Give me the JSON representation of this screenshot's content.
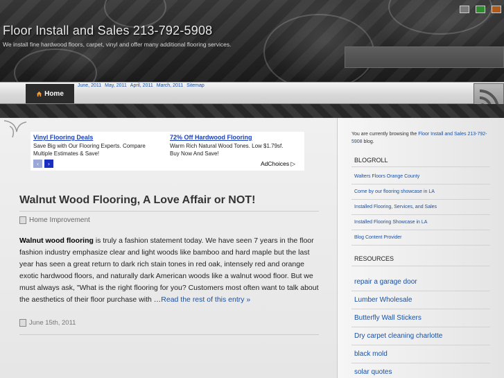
{
  "header": {
    "title": "Floor Install and Sales 213-792-5908",
    "description": "We install fine hardwood floors, carpet, vinyl and offer many additional flooring services.",
    "color_swatches": [
      "#7a7a7a",
      "#2e8b2e",
      "#b05a1a"
    ]
  },
  "nav": {
    "home_label": "Home",
    "home_icon": "house-icon",
    "links": [
      "June, 2011",
      "May, 2011",
      "April, 2011",
      "March, 2011",
      "Sitemap"
    ],
    "rss_icon": "rss-icon"
  },
  "ads": {
    "left": {
      "title": "Vinyl Flooring Deals",
      "text_line1": "Save Big with Our Flooring Experts. Compare",
      "text_line2": "Multiple Estimates & Save!"
    },
    "right": {
      "title": "72% Off Hardwood Flooring",
      "text_line1": "Warm Rich Natural Wood Tones. Low $1.79sf.",
      "text_line2": "Buy Now And Save!"
    },
    "prev_arrow": "‹",
    "next_arrow": "›",
    "adchoices_label": "AdChoices"
  },
  "post": {
    "title": "Walnut Wood Flooring, A Love Affair or NOT!",
    "category": "Home Improvement",
    "lead": "Walnut wood flooring",
    "body": " is truly a fashion statement today. We have seen 7 years in the floor fashion industry emphasize clear and light woods like bamboo and hard maple but the last year has seen a great return to dark rich stain tones in red oak, intensely red and orange exotic hardwood floors, and naturally dark American woods like a walnut wood floor. But we must always ask, \"What is the right flooring for you? Customers most often want to talk about the aesthetics of their floor purchase with …",
    "read_more": "Read the rest of this entry »",
    "date": "June 15th, 2011"
  },
  "sidebar": {
    "browsing_prefix": "You are currently browsing the ",
    "browsing_link": "Floor Install and Sales 213-792-5908",
    "browsing_suffix": " blog.",
    "blogroll_heading": "BLOGROLL",
    "blogroll": [
      "Walters Floors Orange County",
      "Come by our flooring showcase in LA",
      "Installed Flooring, Services, and Sales",
      "Installed Flooring Showcase in LA",
      "Blog Content Provider"
    ],
    "resources_heading": "RESOURCES",
    "resources": [
      "repair a garage door",
      "Lumber Wholesale",
      "Butterfly Wall Stickers",
      "Dry carpet cleaning charlotte",
      "black mold",
      "solar quotes"
    ]
  }
}
